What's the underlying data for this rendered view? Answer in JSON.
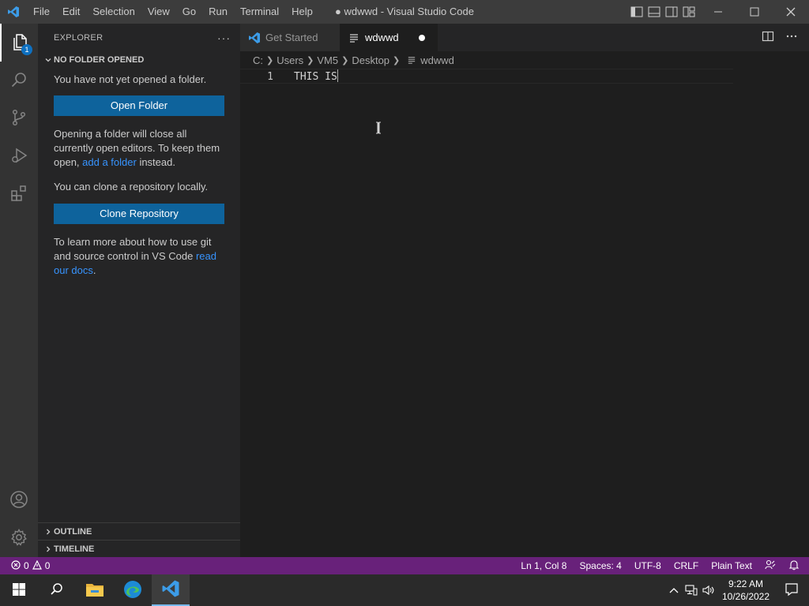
{
  "titlebar": {
    "menu": [
      "File",
      "Edit",
      "Selection",
      "View",
      "Go",
      "Run",
      "Terminal",
      "Help"
    ],
    "window_title": "● wdwwd - Visual Studio Code"
  },
  "activity_bar": {
    "explorer_badge": "1",
    "icons": [
      "files-icon",
      "search-icon",
      "source-control-icon",
      "run-debug-icon",
      "extensions-icon",
      "account-icon",
      "gear-icon"
    ]
  },
  "sidebar": {
    "header": "EXPLORER",
    "more": "···",
    "section_title": "NO FOLDER OPENED",
    "no_folder_text": "You have not yet opened a folder.",
    "open_folder_label": "Open Folder",
    "opening_text_1": "Opening a folder will close all currently open editors. To keep them open, ",
    "add_folder_link": "add a folder",
    "opening_text_2": " instead.",
    "clone_text": "You can clone a repository locally.",
    "clone_label": "Clone Repository",
    "learn_text": "To learn more about how to use git and source control in VS Code ",
    "docs_link": "read our docs",
    "learn_end": ".",
    "outline_label": "OUTLINE",
    "timeline_label": "TIMELINE"
  },
  "tabs": [
    {
      "label": "Get Started",
      "active": false
    },
    {
      "label": "wdwwd",
      "active": true,
      "dirty": true
    }
  ],
  "breadcrumb": [
    "C:",
    "Users",
    "VM5",
    "Desktop",
    "wdwwd"
  ],
  "editor": {
    "line_number": "1",
    "line_text": "THIS IS"
  },
  "statusbar": {
    "errors": "0",
    "warnings": "0",
    "position": "Ln 1, Col 8",
    "spaces": "Spaces: 4",
    "encoding": "UTF-8",
    "eol": "CRLF",
    "language": "Plain Text"
  },
  "taskbar": {
    "time": "9:22 AM",
    "date": "10/26/2022"
  },
  "colors": {
    "accent": "#0e639c",
    "statusbar": "#68217a",
    "link": "#3794ff"
  }
}
